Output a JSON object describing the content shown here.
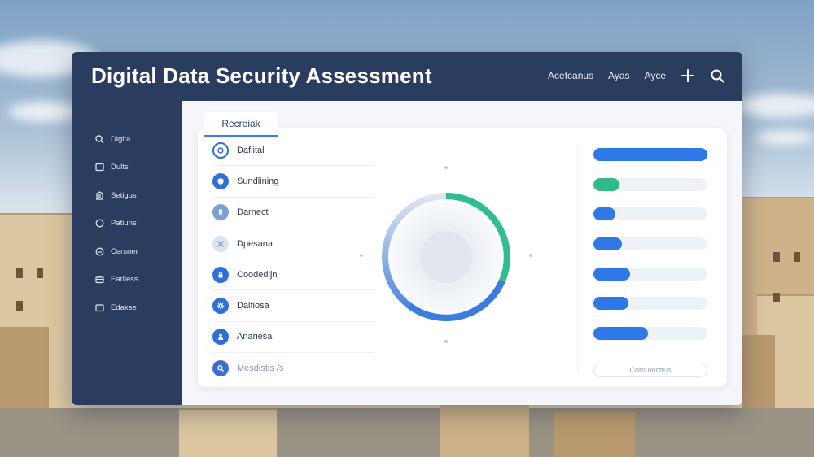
{
  "app": {
    "title": "Digital Data Security Assessment",
    "nav_links": [
      "Acetcanus",
      "Ayas",
      "Ayce"
    ]
  },
  "sidebar": {
    "items": [
      {
        "label": "Digita",
        "icon": "search-icon"
      },
      {
        "label": "Dults",
        "icon": "square-icon"
      },
      {
        "label": "Setigus",
        "icon": "cabinet-icon"
      },
      {
        "label": "Patiuns",
        "icon": "circle-icon"
      },
      {
        "label": "Cersner",
        "icon": "gauge-icon"
      },
      {
        "label": "Earlless",
        "icon": "briefcase-icon"
      },
      {
        "label": "Edakse",
        "icon": "window-icon"
      }
    ]
  },
  "main": {
    "tab_label": "Recreiak",
    "list": [
      {
        "label": "Dafiital",
        "icon": "circle-outline-icon",
        "color": "#2f6fd6"
      },
      {
        "label": "Sundlining",
        "icon": "shield-icon",
        "color": "#2f6fd6"
      },
      {
        "label": "Darnect",
        "icon": "bookmark-icon",
        "color": "#7f9ed6"
      },
      {
        "label": "Dpesana",
        "icon": "cross-icon",
        "color": "#b9c6da"
      },
      {
        "label": "Coodedijn",
        "icon": "lock-icon",
        "color": "#2f6fd6"
      },
      {
        "label": "Dalfiosa",
        "icon": "gear-icon",
        "color": "#2f6fd6"
      },
      {
        "label": "Anariesa",
        "icon": "person-icon",
        "color": "#2f6fd6"
      },
      {
        "label": "Mesdistis /s",
        "icon": "search-icon",
        "color": "#3a6fd1"
      }
    ],
    "ring": {
      "blue_color": "#3b7ddd",
      "green_color": "#2fbf8e",
      "track_color": "#dfe6f0"
    },
    "bars": [
      {
        "value": 1.0,
        "color": "#2f79e6"
      },
      {
        "value": 0.23,
        "color": "#31b98a"
      },
      {
        "value": 0.19,
        "color": "#2f79e6"
      },
      {
        "value": 0.25,
        "color": "#2f79e6"
      },
      {
        "value": 0.32,
        "color": "#2f79e6"
      },
      {
        "value": 0.31,
        "color": "#2f79e6"
      },
      {
        "value": 0.48,
        "color": "#2f79e6"
      }
    ],
    "more_button": "Corn oocttus"
  }
}
